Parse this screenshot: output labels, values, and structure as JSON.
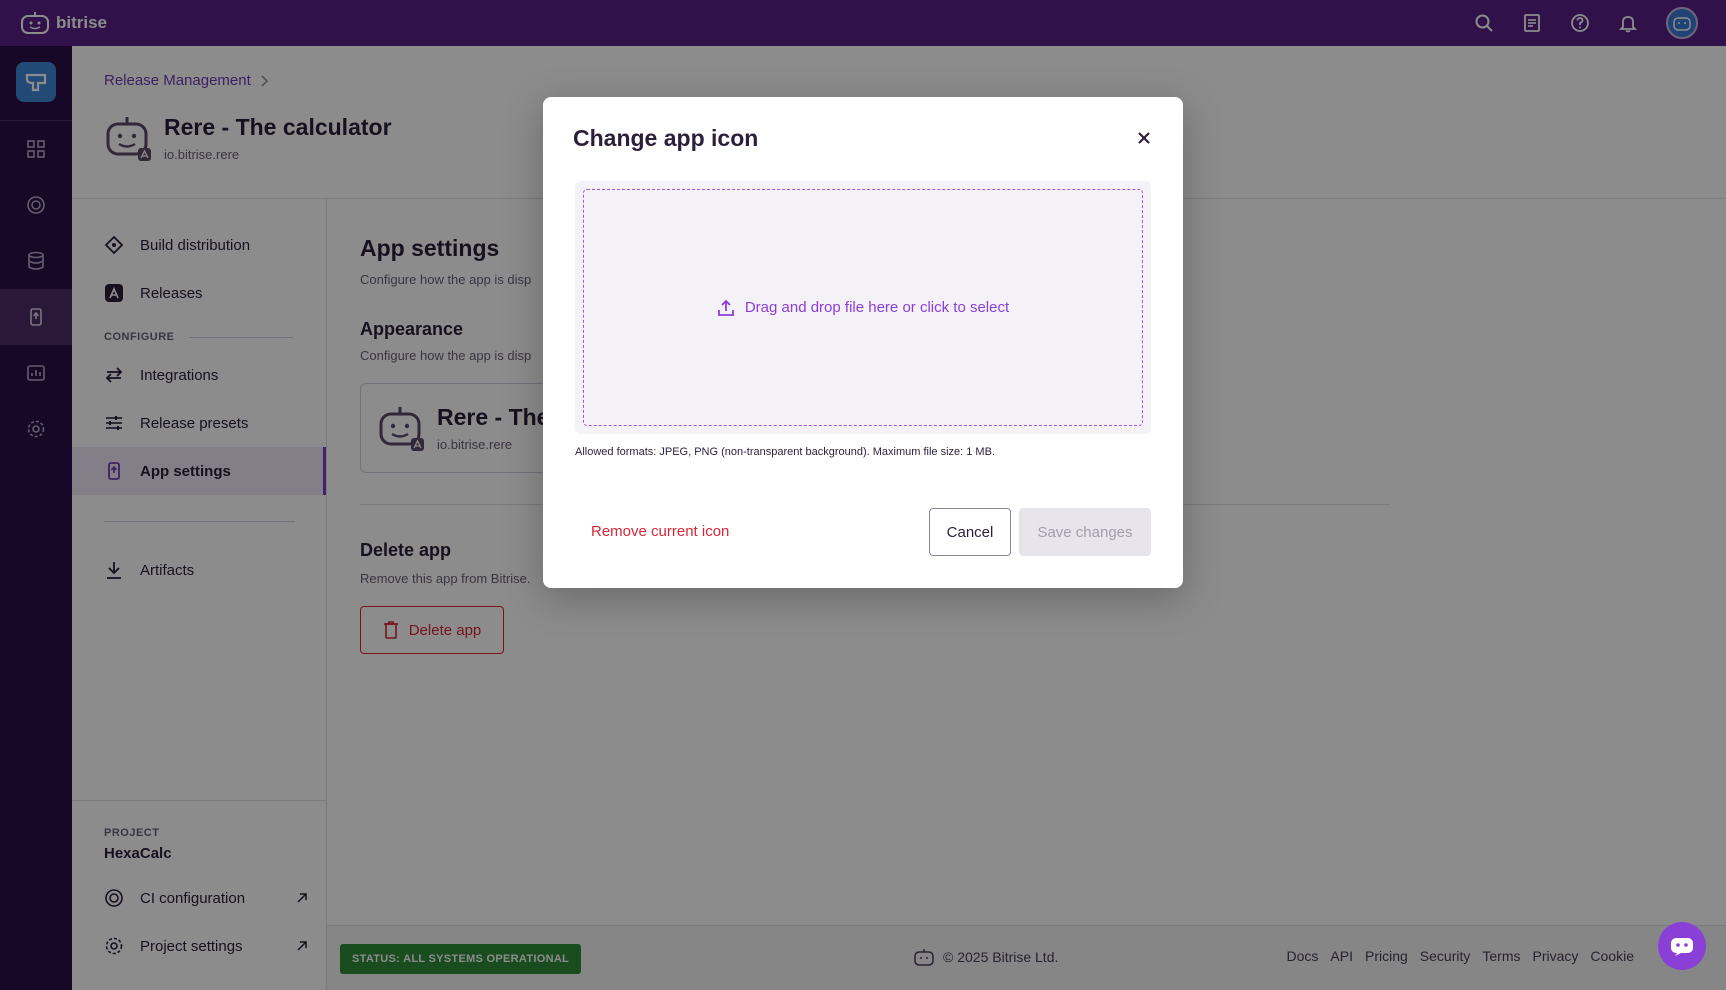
{
  "topbar": {
    "brand": "bitrise"
  },
  "breadcrumb": {
    "item": "Release Management"
  },
  "app": {
    "name": "Rere - The calculator",
    "bundle_id": "io.bitrise.rere"
  },
  "sidenav": {
    "items": [
      "Build distribution",
      "Releases"
    ],
    "section_configure": "CONFIGURE",
    "configure_items": [
      "Integrations",
      "Release presets",
      "App settings"
    ],
    "artifacts": "Artifacts",
    "project_label": "PROJECT",
    "project_name": "HexaCalc",
    "project_links": [
      "CI configuration",
      "Project settings"
    ]
  },
  "main": {
    "title": "App settings",
    "desc": "Configure how the app is disp",
    "appearance_title": "Appearance",
    "appearance_desc": "Configure how the app is disp",
    "card_title": "Rere - The",
    "card_sub": "io.bitrise.rere",
    "delete_title": "Delete app",
    "delete_desc": "Remove this app from Bitrise.",
    "delete_button": "Delete app"
  },
  "footer": {
    "status": "STATUS: ALL SYSTEMS OPERATIONAL",
    "copyright": "© 2025 Bitrise Ltd.",
    "links": [
      "Docs",
      "API",
      "Pricing",
      "Security",
      "Terms",
      "Privacy",
      "Cookie"
    ]
  },
  "modal": {
    "title": "Change app icon",
    "dropzone_text": "Drag and drop file here or click to select",
    "hint": "Allowed formats: JPEG, PNG (non-transparent background). Maximum file size: 1 MB.",
    "remove_label": "Remove current icon",
    "cancel_label": "Cancel",
    "save_label": "Save changes"
  },
  "colors": {
    "brand": "#5a1f86",
    "rail": "#2d0f47",
    "accent": "#8a3fd6",
    "danger": "#d6263a",
    "status": "#2e8b3a"
  }
}
